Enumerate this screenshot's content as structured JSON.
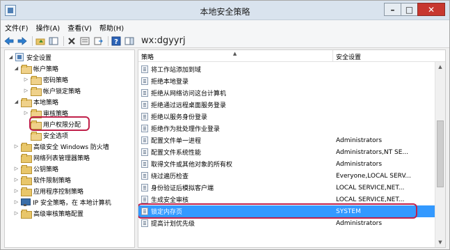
{
  "window": {
    "title": "本地安全策略",
    "controls": {
      "minimize": "–",
      "maximize": "□",
      "close": "✕"
    }
  },
  "menu": [
    {
      "label": "文件(F)"
    },
    {
      "label": "操作(A)"
    },
    {
      "label": "查看(V)"
    },
    {
      "label": "帮助(H)"
    }
  ],
  "toolbar": {
    "icons": [
      "back-arrow-icon",
      "forward-arrow-icon",
      "up-folder-icon",
      "show-hide-tree-icon",
      "delete-icon",
      "properties-icon",
      "export-list-icon",
      "help-icon",
      "console-pane-icon"
    ],
    "overlay_text": "wx:dgyyrj"
  },
  "tree": [
    {
      "label": "安全设置",
      "level": 0,
      "expander": "◢",
      "icon": "root"
    },
    {
      "label": "帐户策略",
      "level": 1,
      "expander": "◢",
      "icon": "folder"
    },
    {
      "label": "密码策略",
      "level": 2,
      "expander": "▷",
      "icon": "folder"
    },
    {
      "label": "帐户锁定策略",
      "level": 2,
      "expander": "▷",
      "icon": "folder"
    },
    {
      "label": "本地策略",
      "level": 1,
      "expander": "◢",
      "icon": "folder"
    },
    {
      "label": "审核策略",
      "level": 2,
      "expander": "▷",
      "icon": "folder"
    },
    {
      "label": "用户权限分配",
      "level": 2,
      "expander": "",
      "icon": "folder",
      "highlighted": true
    },
    {
      "label": "安全选项",
      "level": 2,
      "expander": "",
      "icon": "folder"
    },
    {
      "label": "高级安全 Windows 防火墙",
      "level": 1,
      "expander": "▷",
      "icon": "folder"
    },
    {
      "label": "网络列表管理器策略",
      "level": 1,
      "expander": "",
      "icon": "folder"
    },
    {
      "label": "公钥策略",
      "level": 1,
      "expander": "▷",
      "icon": "folder"
    },
    {
      "label": "软件限制策略",
      "level": 1,
      "expander": "▷",
      "icon": "folder"
    },
    {
      "label": "应用程序控制策略",
      "level": 1,
      "expander": "▷",
      "icon": "folder"
    },
    {
      "label": "IP 安全策略，在 本地计算机",
      "level": 1,
      "expander": "▷",
      "icon": "monitor"
    },
    {
      "label": "高级审核策略配置",
      "level": 1,
      "expander": "▷",
      "icon": "folder"
    }
  ],
  "columns": {
    "policy": "策略",
    "setting": "安全设置",
    "sort_glyph": "▲"
  },
  "policies": [
    {
      "name": "将工作站添加到域",
      "setting": ""
    },
    {
      "name": "拒绝本地登录",
      "setting": ""
    },
    {
      "name": "拒绝从网络访问这台计算机",
      "setting": ""
    },
    {
      "name": "拒绝通过远程桌面服务登录",
      "setting": ""
    },
    {
      "name": "拒绝以服务身份登录",
      "setting": ""
    },
    {
      "name": "拒绝作为批处理作业登录",
      "setting": ""
    },
    {
      "name": "配置文件单一进程",
      "setting": "Administrators"
    },
    {
      "name": "配置文件系统性能",
      "setting": "Administrators,NT SE..."
    },
    {
      "name": "取得文件或其他对象的所有权",
      "setting": "Administrators"
    },
    {
      "name": "绕过遍历检查",
      "setting": "Everyone,LOCAL SERV..."
    },
    {
      "name": "身份验证后模拟客户端",
      "setting": "LOCAL SERVICE,NET..."
    },
    {
      "name": "生成安全审核",
      "setting": "LOCAL SERVICE,NET..."
    },
    {
      "name": "锁定内存页",
      "setting": "SYSTEM",
      "selected": true
    },
    {
      "name": "提高计划优先级",
      "setting": "Administrators"
    }
  ],
  "scrollbar": {
    "up": "▲",
    "down": "▼"
  },
  "colors": {
    "selection": "#3399ff",
    "annotation": "#c0204a",
    "title_bar": "#d9e3ee",
    "close_button": "#c7372f"
  }
}
